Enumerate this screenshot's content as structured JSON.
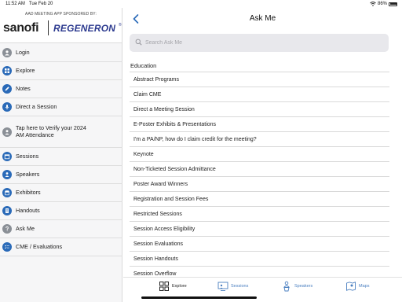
{
  "status_bar": {
    "time": "11:52 AM",
    "date": "Tue Feb 20",
    "battery": "86%"
  },
  "sidebar": {
    "sponsor_text": "AAD MEETING APP SPONSORED BY:",
    "logo_left": "sanofi",
    "logo_right": "REGENERON",
    "logo_right_mark": "®",
    "items": [
      {
        "label": "Login",
        "icon": "user-icon"
      },
      {
        "label": "Explore",
        "icon": "grid-icon"
      },
      {
        "label": "Notes",
        "icon": "pencil-icon"
      },
      {
        "label": "Direct a Session",
        "icon": "microphone-icon"
      },
      {
        "label": "Tap here to Verify your 2024 AM Attendance",
        "icon": "person-badge-icon"
      },
      {
        "label": "Sessions",
        "icon": "calendar-icon"
      },
      {
        "label": "Speakers",
        "icon": "speaker-icon"
      },
      {
        "label": "Exhibitors",
        "icon": "store-icon"
      },
      {
        "label": "Handouts",
        "icon": "document-icon"
      },
      {
        "label": "Ask Me",
        "icon": "question-icon"
      },
      {
        "label": "CME / Evaluations",
        "icon": "checklist-icon"
      }
    ]
  },
  "main": {
    "title": "Ask Me",
    "search_placeholder": "Search Ask Me",
    "section": "Education",
    "rows": [
      "Abstract Programs",
      "Claim CME",
      "Direct a  Meeting Session",
      "E-Poster Exhibits & Presentations",
      "I'm a PA/NP, how do I claim credit for the meeting?",
      "Keynote",
      "Non-Ticketed Session Admittance",
      "Poster Award Winners",
      "Registration and Session Fees",
      "Restricted Sessions",
      "Session Access Eligibility",
      "Session Evaluations",
      "Session Handouts",
      "Session Overflow"
    ]
  },
  "tabbar": {
    "tabs": [
      {
        "label": "Explore"
      },
      {
        "label": "Sessions"
      },
      {
        "label": "Speakers"
      },
      {
        "label": "Maps"
      }
    ]
  }
}
